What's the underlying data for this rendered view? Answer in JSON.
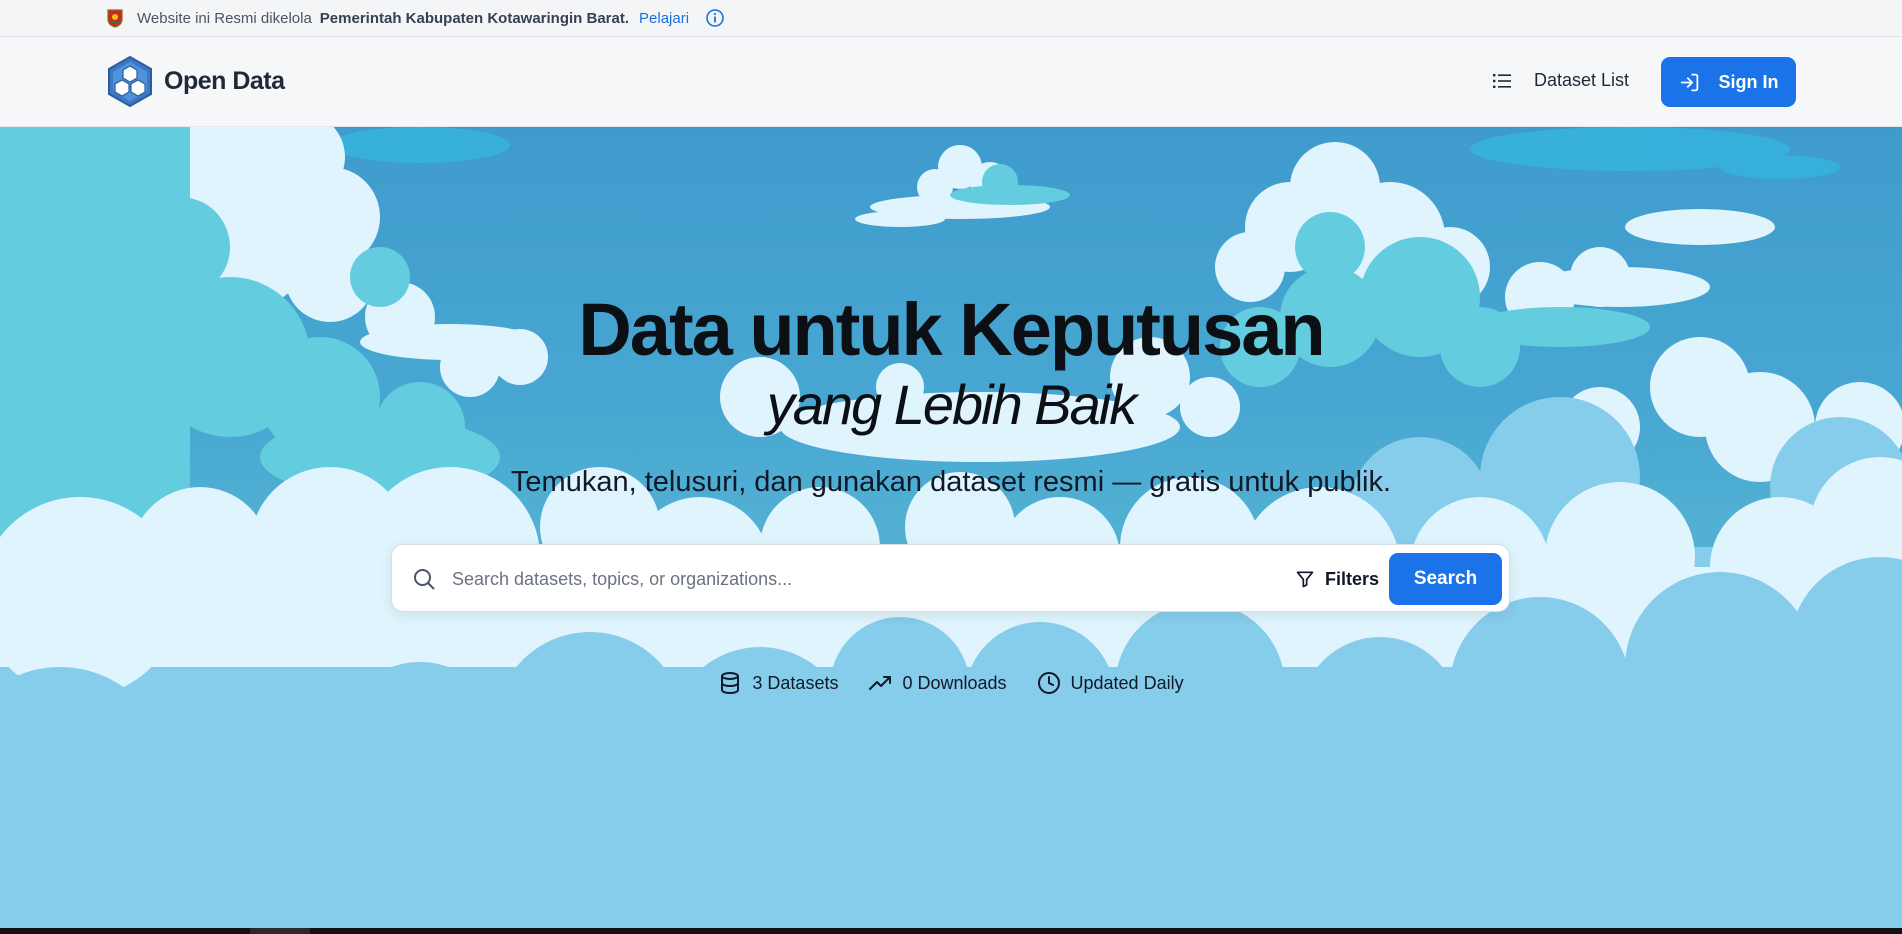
{
  "gov_bar": {
    "text": "Website ini Resmi dikelola",
    "org": "Pemerintah Kabupaten Kotawaringin Barat.",
    "learn": "Pelajari"
  },
  "nav": {
    "brand": "Open Data",
    "dataset_list": "Dataset List",
    "sign_in": "Sign In"
  },
  "hero": {
    "title": "Data untuk Keputusan",
    "subtitle": "yang Lebih Baik",
    "description": "Temukan, telusuri, dan gunakan dataset resmi — gratis untuk publik."
  },
  "search": {
    "placeholder": "Search datasets, topics, or organizations...",
    "filters": "Filters",
    "button": "Search"
  },
  "stats": [
    {
      "icon": "database-icon",
      "label": "3 Datasets"
    },
    {
      "icon": "trending-up-icon",
      "label": "0 Downloads"
    },
    {
      "icon": "clock-icon",
      "label": "Updated Daily"
    }
  ],
  "colors": {
    "primary": "#1a73e8",
    "sky_top": "#3f9bcc",
    "sky_bottom": "#6ac8cf",
    "cloud_light": "#dff4fc",
    "cloud_mid": "#6cd0e0",
    "cloud_deep": "#86cdeb"
  },
  "icons": {
    "emblem": "regency-emblem-icon",
    "info": "info-icon",
    "logo": "hexagon-cubes-logo",
    "list": "list-icon",
    "signin": "log-in-icon",
    "search": "search-icon",
    "filter": "filter-icon"
  }
}
